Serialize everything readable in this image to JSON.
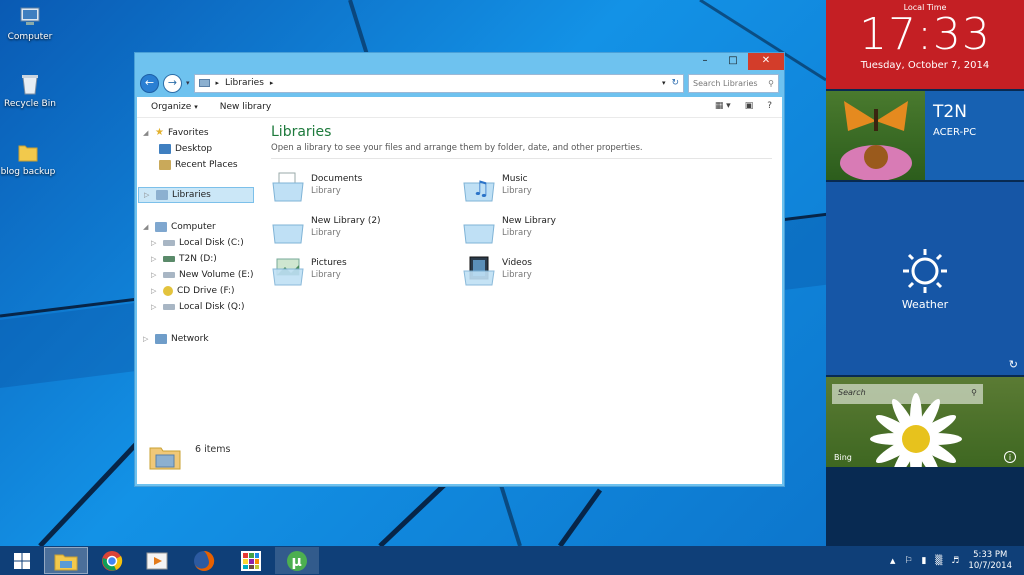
{
  "desktop": {
    "icons": [
      {
        "label": "Computer",
        "icon": "computer-icon"
      },
      {
        "label": "Recycle Bin",
        "icon": "recycle-bin-icon"
      },
      {
        "label": "blog backup",
        "icon": "folder-icon"
      }
    ]
  },
  "explorer": {
    "address": "Libraries",
    "search_placeholder": "Search Libraries",
    "toolbar": {
      "organize": "Organize",
      "new_library": "New library",
      "help": "?"
    },
    "nav": {
      "favorites": "Favorites",
      "desktop": "Desktop",
      "recent_places": "Recent Places",
      "libraries": "Libraries",
      "computer": "Computer",
      "drives": [
        "Local Disk (C:)",
        "T2N (D:)",
        "New Volume (E:)",
        "CD Drive (F:)",
        "Local Disk (Q:)"
      ],
      "network": "Network"
    },
    "content": {
      "title": "Libraries",
      "description": "Open a library to see your files and arrange them by folder, date, and other properties.",
      "items": [
        {
          "name": "Documents",
          "type": "Library"
        },
        {
          "name": "Music",
          "type": "Library"
        },
        {
          "name": "New Library (2)",
          "type": "Library"
        },
        {
          "name": "New Library",
          "type": "Library"
        },
        {
          "name": "Pictures",
          "type": "Library"
        },
        {
          "name": "Videos",
          "type": "Library"
        }
      ]
    },
    "details": {
      "count": "6 items"
    }
  },
  "panel": {
    "clock": {
      "label": "Local Time",
      "time": "17:33",
      "date": "Tuesday, October 7, 2014"
    },
    "user": {
      "name": "T2N",
      "pc": "ACER-PC"
    },
    "weather": {
      "label": "Weather"
    },
    "bing": {
      "search_placeholder": "Search",
      "label": "Bing"
    }
  },
  "taskbar": {
    "apps": [
      "file-explorer-icon",
      "chrome-icon",
      "media-player-icon",
      "firefox-icon",
      "apps-icon",
      "utorrent-icon"
    ],
    "time": "5:33 PM",
    "date": "10/7/2014"
  },
  "colors": {
    "accent_clock": "#c41f24",
    "user_tile": "#1761b2",
    "weather_tile": "#1656a6",
    "library_title": "#1e7a3c",
    "taskbar": "#0f3f78"
  }
}
